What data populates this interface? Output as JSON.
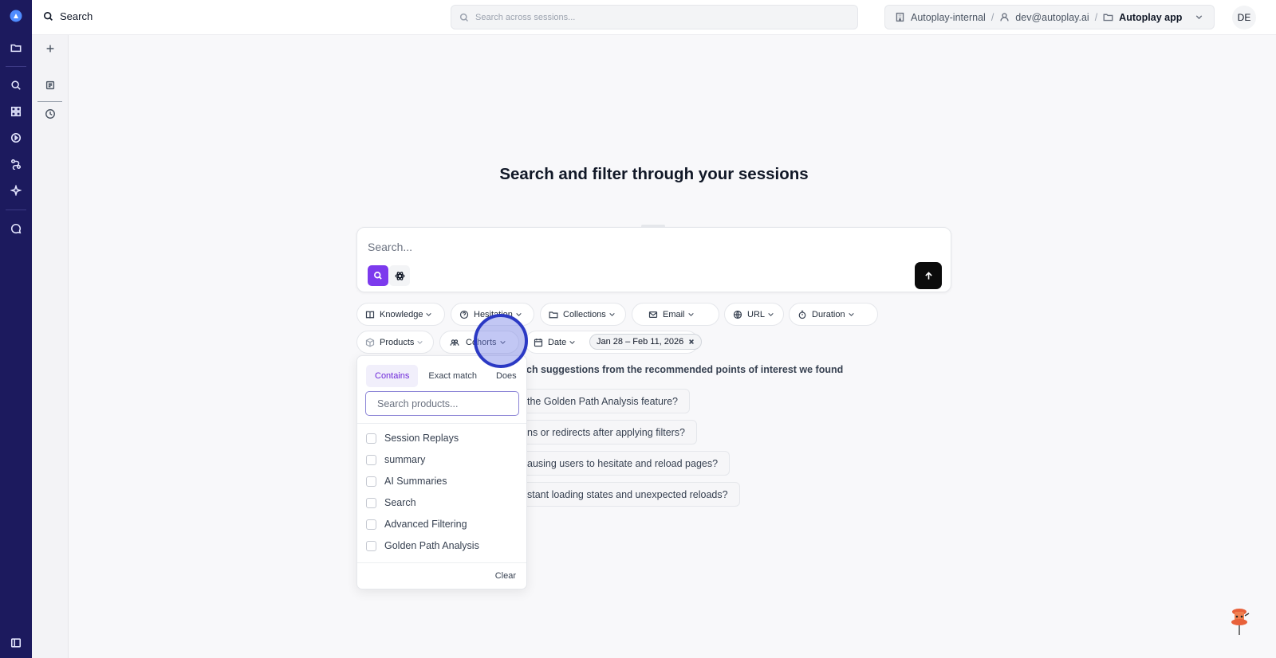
{
  "header": {
    "title": "Search",
    "global_search_placeholder": "Search across sessions...",
    "breadcrumb": {
      "org": "Autoplay-internal",
      "user": "dev@autoplay.ai",
      "project": "Autoplay app",
      "separator": "/"
    },
    "avatar_initials": "DE"
  },
  "rail": {
    "icons": [
      "logo-icon",
      "folder-icon",
      "search-icon",
      "dashboard-icon",
      "play-icon",
      "workflow-icon",
      "sparkle-icon",
      "chat-icon",
      "sidebar-toggle-icon"
    ]
  },
  "main": {
    "headline": "Search and filter through your sessions",
    "search_placeholder": "Search...",
    "filters_row1": [
      {
        "label": "Knowledge",
        "icon": "book-icon"
      },
      {
        "label": "Hesitation",
        "icon": "question-icon"
      },
      {
        "label": "Collections",
        "icon": "folder-icon"
      },
      {
        "label": "Email",
        "icon": "mail-icon"
      },
      {
        "label": "URL",
        "icon": "globe-icon"
      },
      {
        "label": "Duration",
        "icon": "timer-icon"
      }
    ],
    "filters_row2": [
      {
        "label": "Products",
        "icon": "box-icon"
      },
      {
        "label": "Cohorts",
        "icon": "users-icon"
      },
      {
        "label": "Date",
        "icon": "calendar-icon"
      }
    ],
    "date_range": "Jan 28 – Feb 11, 2026",
    "suggestions_heading": "ch suggestions from the recommended points of interest we found",
    "suggestions": [
      "the Golden Path Analysis feature?",
      "ns or redirects after applying filters?",
      "ausing users to hesitate and reload pages?",
      "stant loading states and unexpected reloads?"
    ]
  },
  "products_dropdown": {
    "tabs": [
      "Contains",
      "Exact match",
      "Does nc"
    ],
    "active_tab": "Contains",
    "search_placeholder": "Search products...",
    "items": [
      "Session Replays",
      "summary",
      "AI Summaries",
      "Search",
      "Advanced Filtering",
      "Golden Path Analysis"
    ],
    "clear_label": "Clear"
  },
  "colors": {
    "rail": "#1c1a5e",
    "accent": "#7c3aed",
    "send_button": "#0b0b0b"
  }
}
